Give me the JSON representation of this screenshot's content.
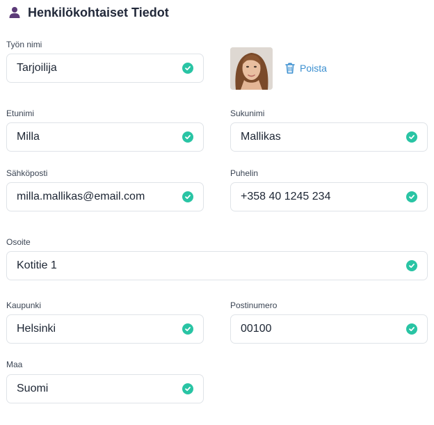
{
  "section": {
    "title": "Henkilökohtaiset Tiedot",
    "icon": "person-icon"
  },
  "photo": {
    "remove_label": "Poista",
    "icon": "trash-icon"
  },
  "fields": {
    "job_title": {
      "label": "Työn nimi",
      "value": "Tarjoilija"
    },
    "first_name": {
      "label": "Etunimi",
      "value": "Milla"
    },
    "last_name": {
      "label": "Sukunimi",
      "value": "Mallikas"
    },
    "email": {
      "label": "Sähköposti",
      "value": "milla.mallikas@email.com"
    },
    "phone": {
      "label": "Puhelin",
      "value": "+358 40 1245 234"
    },
    "address": {
      "label": "Osoite",
      "value": "Kotitie 1"
    },
    "city": {
      "label": "Kaupunki",
      "value": "Helsinki"
    },
    "postal_code": {
      "label": "Postinumero",
      "value": "00100"
    },
    "country": {
      "label": "Maa",
      "value": "Suomi"
    }
  },
  "colors": {
    "valid_check": "#29c4a4",
    "link": "#3b8fd0",
    "person_icon": "#5b3a78"
  }
}
